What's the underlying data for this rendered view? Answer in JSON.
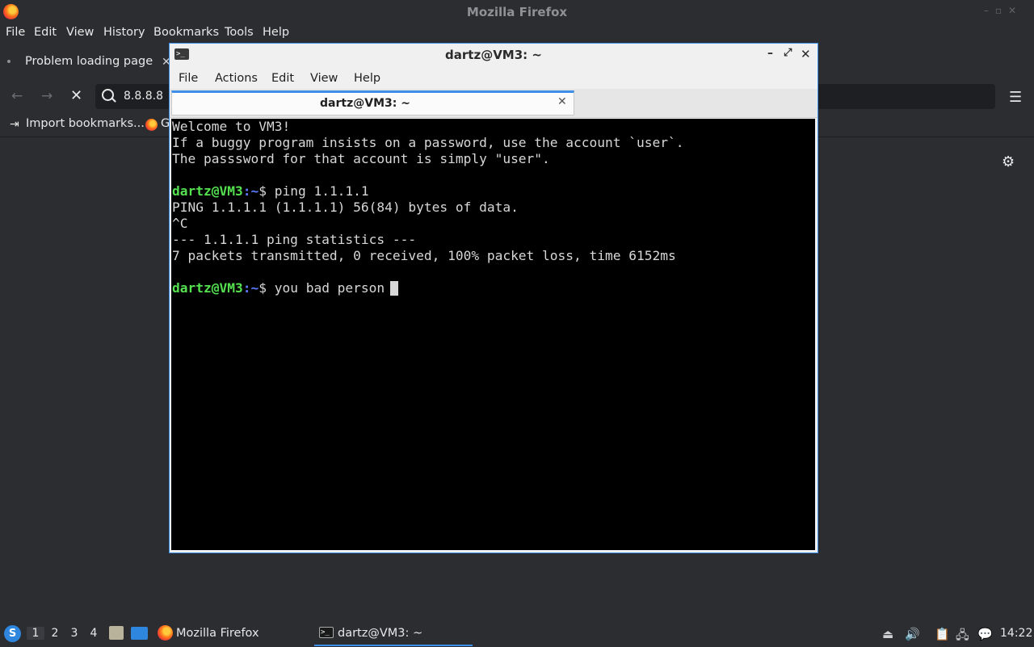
{
  "firefox": {
    "window_title": "Mozilla Firefox",
    "menu": [
      "File",
      "Edit",
      "View",
      "History",
      "Bookmarks",
      "Tools",
      "Help"
    ],
    "tab_title": "Problem loading page",
    "url": "8.8.8.8",
    "bookmarks": {
      "import_label": "Import bookmarks...",
      "second_label": "G"
    }
  },
  "terminal": {
    "window_title": "dartz@VM3: ~",
    "menu": [
      "File",
      "Actions",
      "Edit",
      "View",
      "Help"
    ],
    "tab_label": "dartz@VM3: ~",
    "lines": [
      "Welcome to VM3!",
      "If a buggy program insists on a password, use the account `user`.",
      "The passsword for that account is simply \"user\"."
    ],
    "prompt_user": "dartz@VM3",
    "prompt_path": ":~",
    "prompt_symbol": "$ ",
    "command1": "ping 1.1.1.1",
    "output": [
      "PING 1.1.1.1 (1.1.1.1) 56(84) bytes of data.",
      "^C",
      "--- 1.1.1.1 ping statistics ---",
      "7 packets transmitted, 0 received, 100% packet loss, time 6152ms"
    ],
    "command2": "you bad person"
  },
  "taskbar": {
    "workspaces": [
      "1",
      "2",
      "3",
      "4"
    ],
    "active_workspace": "1",
    "firefox_label": "Mozilla Firefox",
    "terminal_label": "dartz@VM3: ~",
    "clock": "14:22"
  },
  "colors": {
    "accent": "#3d8ee6",
    "prompt_user": "#54e04f",
    "prompt_path": "#5c7cff",
    "terminal_bg": "#000000",
    "chrome_bg": "#2b2d31"
  }
}
